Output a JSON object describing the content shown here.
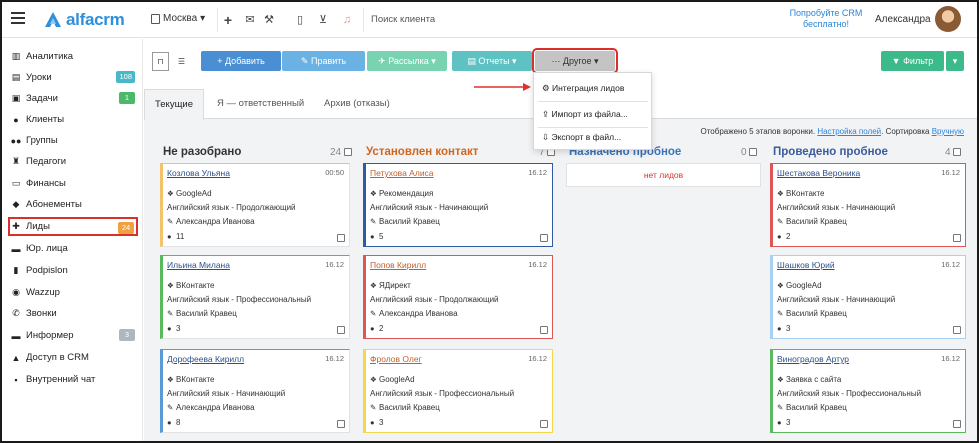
{
  "topbar": {
    "logo_text": "alfacrm",
    "city": "Москва",
    "search_placeholder": "Поиск клиента",
    "try_free": "Попробуйте CRM бесплатно!",
    "user_name": "Александра"
  },
  "sidebar": {
    "items": [
      {
        "label": "Аналитика",
        "icon": "analytics-icon"
      },
      {
        "label": "Уроки",
        "icon": "lessons-icon",
        "badge": "108",
        "badge_color": "#49b9c9"
      },
      {
        "label": "Задачи",
        "icon": "tasks-icon",
        "badge": "1",
        "badge_color": "#4cb86a"
      },
      {
        "label": "Клиенты",
        "icon": "clients-icon"
      },
      {
        "label": "Группы",
        "icon": "groups-icon"
      },
      {
        "label": "Педагоги",
        "icon": "teachers-icon"
      },
      {
        "label": "Финансы",
        "icon": "finance-icon"
      },
      {
        "label": "Абонементы",
        "icon": "subscriptions-icon"
      },
      {
        "label": "Лиды",
        "icon": "leads-icon",
        "badge": "24",
        "badge_color": "#f0a040",
        "active": true
      },
      {
        "label": "Юр. лица",
        "icon": "legal-entities-icon"
      },
      {
        "label": "Podpislon",
        "icon": "podpislon-icon"
      },
      {
        "label": "Wazzup",
        "icon": "wazzup-icon"
      },
      {
        "label": "Звонки",
        "icon": "calls-icon"
      },
      {
        "label": "Информер",
        "icon": "informer-icon",
        "badge": "3",
        "badge_color": "#b0b6bd"
      },
      {
        "label": "Доступ в CRM",
        "icon": "lock-icon"
      },
      {
        "label": "Внутренний чат",
        "icon": "chat-icon"
      }
    ]
  },
  "toolbar": {
    "add": "+ Добавить",
    "edit": "✎ Править",
    "mailing": "✈ Рассылка ▾",
    "reports": "▤ Отчеты ▾",
    "other": "··· Другое ▾",
    "filter": "▼ Фильтр"
  },
  "dropdown": {
    "items": [
      "Интеграция лидов",
      "Импорт из файла...",
      "Экспорт в файл..."
    ]
  },
  "tabs": [
    "Текущие",
    "Я — ответственный",
    "Архив (отказы)"
  ],
  "info": {
    "prefix": "Отображено 5 этапов воронки.",
    "setup_fields": "Настройка полей",
    "sort_label": ". Сортировка",
    "sort_value": "Вручную"
  },
  "columns": [
    {
      "title": "Не разобрано",
      "count": "24",
      "color": "#333333"
    },
    {
      "title": "Установлен контакт",
      "count": "7",
      "color": "#d1661e"
    },
    {
      "title": "Назначено пробное",
      "count": "0",
      "color": "#3b73b9",
      "empty_text": "нет лидов"
    },
    {
      "title": "Проведено пробное",
      "count": "4",
      "color": "#3b5b9a"
    }
  ],
  "cards": [
    [
      {
        "name": "Козлова Ульяна",
        "date": "00:50",
        "source": "GoogleAd",
        "course": "Английский язык - Продолжающий",
        "manager": "Александра Иванова",
        "comments": "11",
        "border": "#f4c26a"
      },
      {
        "name": "Ильина Милана",
        "date": "16.12",
        "source": "ВКонтакте",
        "course": "Английский язык - Профессиональный",
        "manager": "Василий Кравец",
        "comments": "3",
        "border": "#5cb85c"
      },
      {
        "name": "Дорофеева Кирилл",
        "date": "16.12",
        "source": "ВКонтакте",
        "course": "Английский язык - Начинающий",
        "manager": "Александра Иванова",
        "comments": "8",
        "border": "#5a9bd5"
      }
    ],
    [
      {
        "name": "Петухова Алиса",
        "date": "16.12",
        "source": "Рекомендация",
        "course": "Английский язык - Начинающий",
        "manager": "Василий Кравец",
        "comments": "5",
        "border": "#2f5aa5"
      },
      {
        "name": "Попов Кирилл",
        "date": "16.12",
        "source": "ЯДирект",
        "course": "Английский язык - Продолжающий",
        "manager": "Александра Иванова",
        "comments": "2",
        "border": "#e05555"
      },
      {
        "name": "Фролов Олег",
        "date": "16.12",
        "source": "GoogleAd",
        "course": "Английский язык - Профессиональный",
        "manager": "Василий Кравец",
        "comments": "3",
        "border": "#f4d84a"
      }
    ],
    [],
    [
      {
        "name": "Шестакова Вероника",
        "date": "16.12",
        "source": "ВКонтакте",
        "course": "Английский язык - Начинающий",
        "manager": "Василий Кравец",
        "comments": "2",
        "border": "#e05555"
      },
      {
        "name": "Шашков Юрий",
        "date": "16.12",
        "source": "GoogleAd",
        "course": "Английский язык - Начинающий",
        "manager": "Василий Кравец",
        "comments": "3",
        "border": "#a8d0f0"
      },
      {
        "name": "Виноградов Артур",
        "date": "16.12",
        "source": "Заявка с сайта",
        "course": "Английский язык - Профессиональный",
        "manager": "Василий Кравец",
        "comments": "3",
        "border": "#5cb85c"
      }
    ]
  ]
}
